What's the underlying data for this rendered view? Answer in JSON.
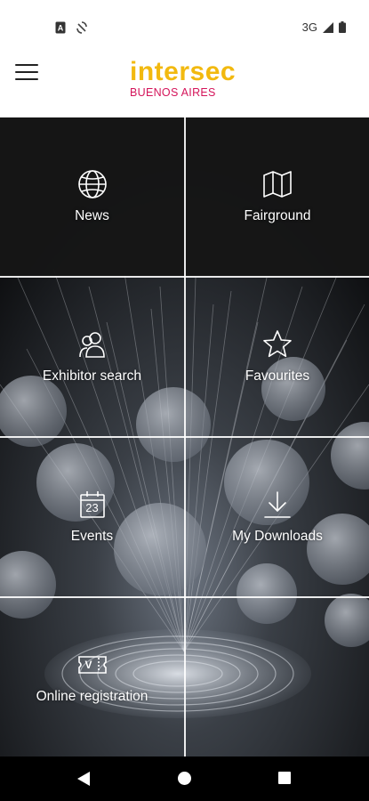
{
  "status_bar": {
    "network": "3G",
    "icons": [
      "notification-a-icon",
      "sync-icon",
      "signal-icon",
      "battery-icon"
    ]
  },
  "header": {
    "logo_main": "intersec",
    "logo_sub": "BUENOS AIRES",
    "menu_icon": "hamburger-menu-icon"
  },
  "tiles": [
    {
      "label": "News",
      "icon": "globe-icon"
    },
    {
      "label": "Fairground",
      "icon": "map-icon"
    },
    {
      "label": "Exhibitor search",
      "icon": "people-icon"
    },
    {
      "label": "Favourites",
      "icon": "star-icon"
    },
    {
      "label": "Events",
      "icon": "calendar-icon",
      "icon_text": "23"
    },
    {
      "label": "My Downloads",
      "icon": "download-icon"
    },
    {
      "label": "Online registration",
      "icon": "ticket-icon",
      "icon_text": "V"
    }
  ],
  "nav_bar": {
    "buttons": [
      "back-button",
      "home-button",
      "recents-button"
    ]
  },
  "colors": {
    "logo_yellow": "#f2b90f",
    "logo_magenta": "#d4145a",
    "tile_dark": "#161616"
  }
}
